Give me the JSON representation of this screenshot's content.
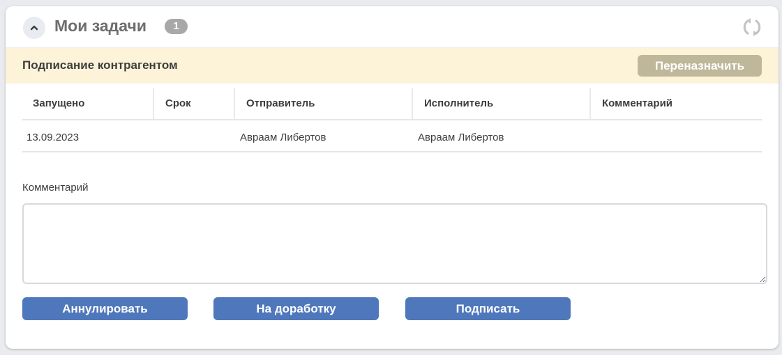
{
  "header": {
    "title": "Мои задачи",
    "count": "1",
    "collapse_icon": "chevron-up-icon",
    "refresh_icon": "refresh-icon"
  },
  "task": {
    "title": "Подписание контрагентом",
    "reassign_label": "Переназначить"
  },
  "table": {
    "columns": [
      "Запущено",
      "Срок",
      "Отправитель",
      "Исполнитель",
      "Комментарий"
    ],
    "rows": [
      {
        "started": "13.09.2023",
        "deadline": "",
        "sender": "Авраам Либертов",
        "executor": "Авраам Либертов",
        "comment": ""
      }
    ]
  },
  "comment": {
    "label": "Комментарий",
    "value": "",
    "placeholder": ""
  },
  "actions": {
    "cancel_label": "Аннулировать",
    "rework_label": "На доработку",
    "sign_label": "Подписать"
  },
  "colors": {
    "primary_button": "#4f77bb",
    "reassign_button": "#bfb79a",
    "task_bar": "#fcf3d8",
    "badge": "#a8a8a8"
  }
}
